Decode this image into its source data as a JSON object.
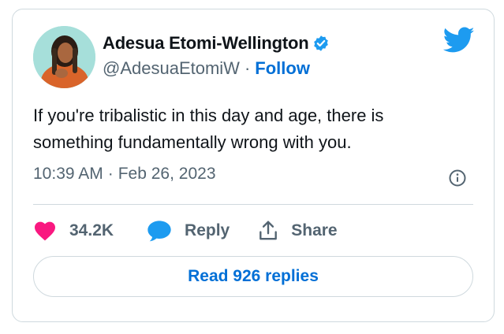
{
  "author": {
    "display_name": "Adesua Etomi-Wellington",
    "handle": "@AdesuaEtomiW",
    "separator": "·",
    "follow_label": "Follow",
    "verified": true
  },
  "tweet": {
    "text_line1": "If you're tribalistic in this day and age, there is",
    "text_line2": "something fundamentally wrong with you.",
    "time": "10:39 AM",
    "separator": "·",
    "date": "Feb 26, 2023"
  },
  "actions": {
    "like_count": "34.2K",
    "reply_label": "Reply",
    "share_label": "Share"
  },
  "read_replies_label": "Read 926 replies",
  "icons": {
    "brand": "twitter-bird-icon",
    "verified": "verified-badge-icon",
    "info": "info-icon",
    "like": "heart-icon",
    "reply": "speech-bubble-icon",
    "share": "share-upload-icon"
  },
  "colors": {
    "accent": "#1d9bf0",
    "link": "#006fd6",
    "like": "#f91880",
    "muted": "#536471",
    "border": "#cfd9de"
  }
}
